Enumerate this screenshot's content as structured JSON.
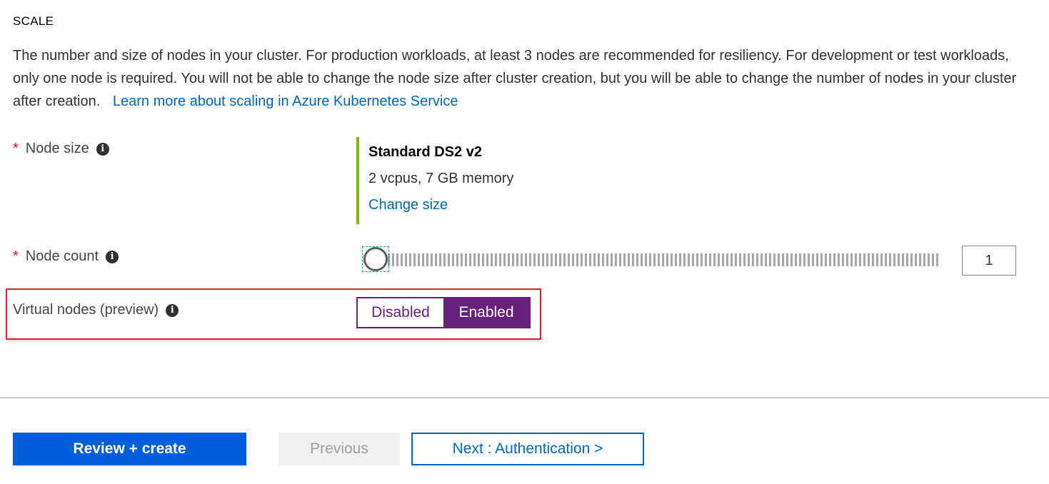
{
  "section": {
    "title": "SCALE",
    "description": "The number and size of nodes in your cluster. For production workloads, at least 3 nodes are recommended for resiliency. For development or test workloads, only one node is required. You will not be able to change the node size after cluster creation, but you will be able to change the number of nodes in your cluster after creation.",
    "learn_more_link": "Learn more about scaling in Azure Kubernetes Service"
  },
  "fields": {
    "node_size": {
      "required_mark": "*",
      "label": "Node size",
      "info": "i",
      "selected_name": "Standard DS2 v2",
      "selected_spec": "2 vcpus, 7 GB memory",
      "change_link": "Change size"
    },
    "node_count": {
      "required_mark": "*",
      "label": "Node count",
      "info": "i",
      "value": "1",
      "slider_fraction": 0
    },
    "virtual_nodes": {
      "label": "Virtual nodes (preview)",
      "info": "i",
      "options": [
        "Disabled",
        "Enabled"
      ],
      "selected": "Enabled"
    }
  },
  "footer": {
    "review_create": "Review + create",
    "previous": "Previous",
    "next": "Next : Authentication >"
  },
  "colors": {
    "accent_purple": "#68217a",
    "link_blue": "#0067b8",
    "primary_button": "#005fd8",
    "node_size_bar": "#7fba00",
    "highlight_red": "#d9262e",
    "required_red": "#e00b1c"
  },
  "icons": {
    "info": "info-icon",
    "slider_thumb": "slider-thumb"
  }
}
